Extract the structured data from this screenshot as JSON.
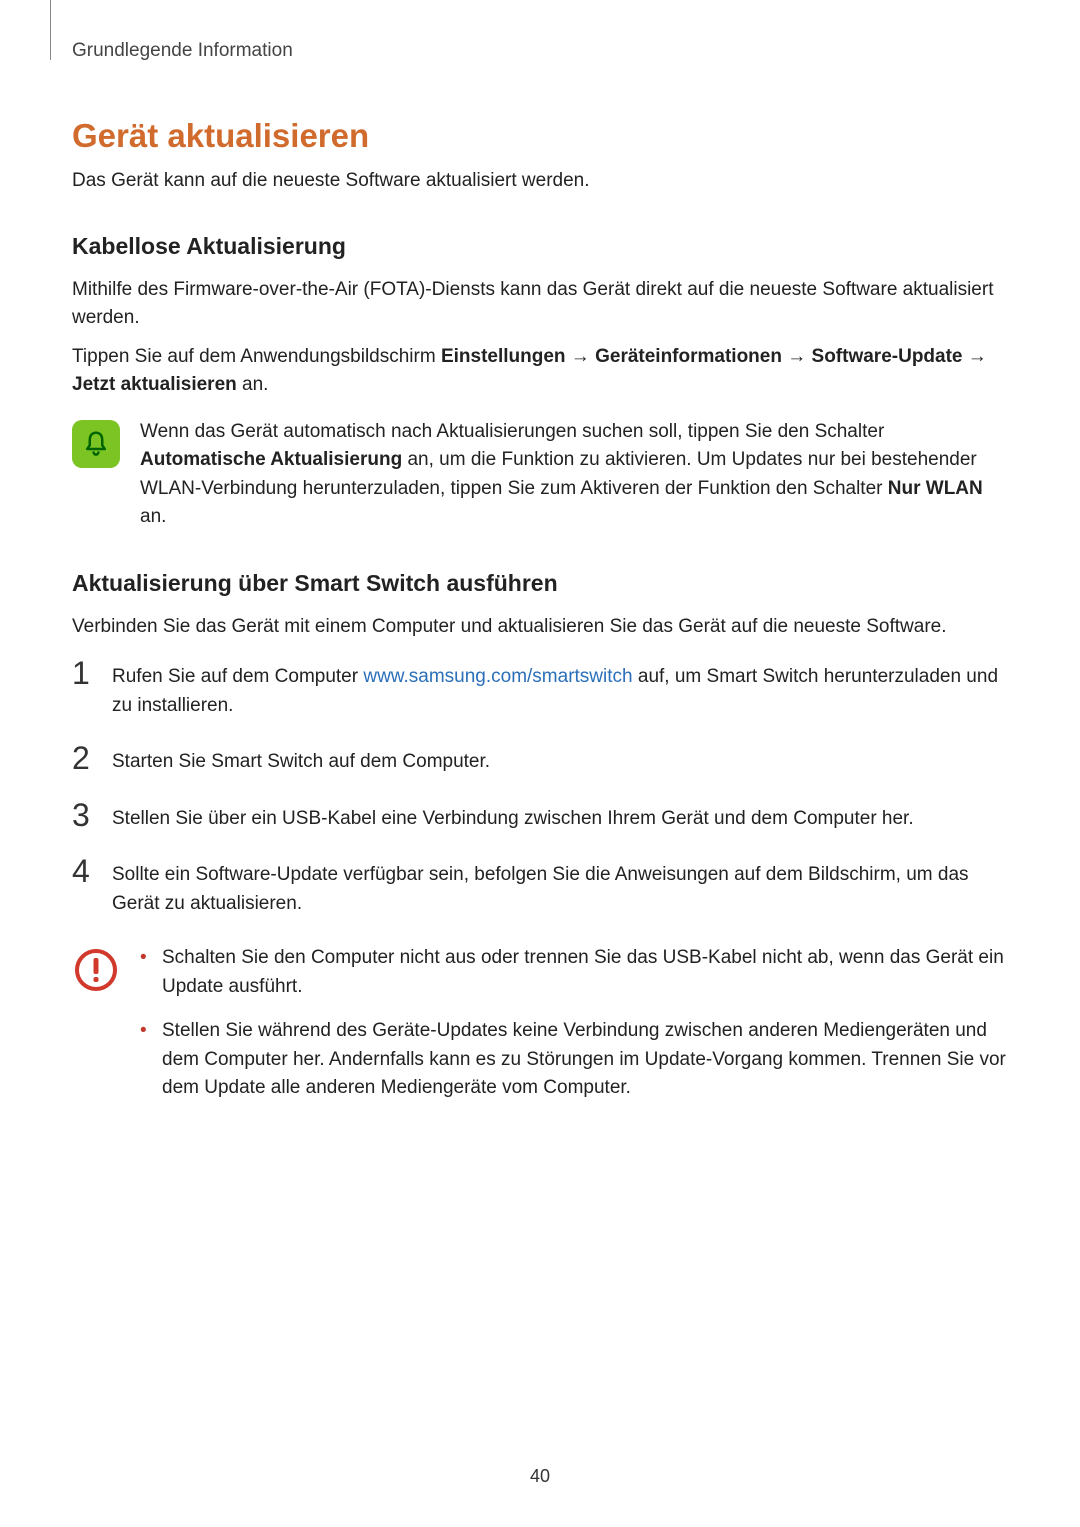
{
  "header": "Grundlegende Information",
  "h1": "Gerät aktualisieren",
  "intro": "Das Gerät kann auf die neueste Software aktualisiert werden.",
  "section1": {
    "title": "Kabellose Aktualisierung",
    "p1": "Mithilfe des Firmware-over-the-Air (FOTA)-Diensts kann das Gerät direkt auf die neueste Software aktualisiert werden.",
    "p2_prefix": "Tippen Sie auf dem Anwendungsbildschirm ",
    "p2_b1": "Einstellungen",
    "arrow": " → ",
    "p2_b2": "Geräteinformationen",
    "p2_b3": "Software-Update",
    "p2_b4": "Jetzt aktualisieren",
    "p2_suffix": " an.",
    "note_t1": "Wenn das Gerät automatisch nach Aktualisierungen suchen soll, tippen Sie den Schalter ",
    "note_b1": "Automatische Aktualisierung",
    "note_t2": " an, um die Funktion zu aktivieren. Um Updates nur bei bestehender WLAN-Verbindung herunterzuladen, tippen Sie zum Aktiveren der Funktion den Schalter ",
    "note_b2": "Nur WLAN",
    "note_t3": " an."
  },
  "section2": {
    "title": "Aktualisierung über Smart Switch ausführen",
    "p1": "Verbinden Sie das Gerät mit einem Computer und aktualisieren Sie das Gerät auf die neueste Software.",
    "steps": {
      "s1_a": "Rufen Sie auf dem Computer ",
      "s1_link": "www.samsung.com/smartswitch",
      "s1_b": " auf, um Smart Switch herunterzuladen und zu installieren.",
      "s2": "Starten Sie Smart Switch auf dem Computer.",
      "s3": "Stellen Sie über ein USB-Kabel eine Verbindung zwischen Ihrem Gerät und dem Computer her.",
      "s4": "Sollte ein Software-Update verfügbar sein, befolgen Sie die Anweisungen auf dem Bildschirm, um das Gerät zu aktualisieren."
    },
    "warnings": {
      "w1": "Schalten Sie den Computer nicht aus oder trennen Sie das USB-Kabel nicht ab, wenn das Gerät ein Update ausführt.",
      "w2": "Stellen Sie während des Geräte-Updates keine Verbindung zwischen anderen Mediengeräten und dem Computer her. Andernfalls kann es zu Störungen im Update-Vorgang kommen. Trennen Sie vor dem Update alle anderen Mediengeräte vom Computer."
    }
  },
  "page_number": "40",
  "nums": {
    "n1": "1",
    "n2": "2",
    "n3": "3",
    "n4": "4"
  },
  "bullet": "•"
}
